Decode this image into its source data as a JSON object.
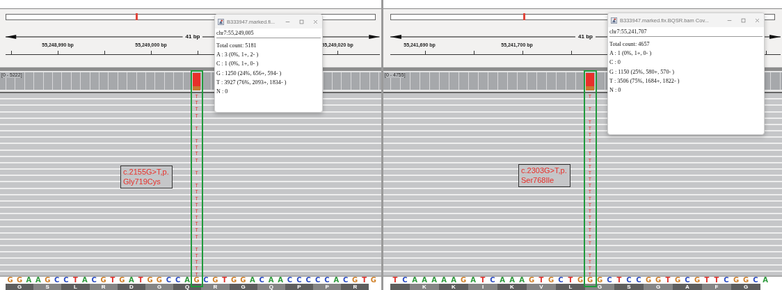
{
  "panels": [
    {
      "ruler": {
        "span_label": "41 bp",
        "ticks": [
          {
            "label": "55,248,990 bp"
          },
          {
            "label": "55,249,000 bp"
          },
          {
            "label": "55,249,020 bp"
          }
        ]
      },
      "coverage": {
        "range": "[0 - 5222]",
        "alleles": [
          {
            "color": "#e8302a",
            "level": 0.76
          },
          {
            "color": "#c9792f",
            "level": 0.24
          }
        ]
      },
      "reads": [
        {
          "mismatch": true,
          "base": "T"
        },
        {
          "mismatch": true,
          "base": "T"
        },
        {
          "mismatch": true,
          "base": "T"
        },
        {
          "mismatch": true,
          "base": "T"
        },
        {
          "mismatch": false
        },
        {
          "mismatch": true,
          "base": "T"
        },
        {
          "mismatch": false
        },
        {
          "mismatch": true,
          "base": "T"
        },
        {
          "mismatch": true,
          "base": "T"
        },
        {
          "mismatch": true,
          "base": "T"
        },
        {
          "mismatch": true,
          "base": "T"
        },
        {
          "mismatch": false
        },
        {
          "mismatch": true,
          "base": "T"
        },
        {
          "mismatch": false
        },
        {
          "mismatch": true,
          "base": "T"
        },
        {
          "mismatch": true,
          "base": "T"
        },
        {
          "mismatch": true,
          "base": "T"
        },
        {
          "mismatch": true,
          "base": "T"
        },
        {
          "mismatch": true,
          "base": "T"
        },
        {
          "mismatch": true,
          "base": "T"
        },
        {
          "mismatch": true,
          "base": "T"
        },
        {
          "mismatch": true,
          "base": "T"
        },
        {
          "mismatch": true,
          "base": "T"
        },
        {
          "mismatch": false
        },
        {
          "mismatch": true,
          "base": "T"
        },
        {
          "mismatch": true,
          "base": "T"
        },
        {
          "mismatch": true,
          "base": "T"
        },
        {
          "mismatch": true,
          "base": "T"
        },
        {
          "mismatch": true,
          "base": "T"
        }
      ],
      "annotation": [
        "c.2155G>T,p.",
        "Gly719Cys"
      ],
      "sequence_before": [
        {
          "base": "G",
          "color": "#d1832e"
        },
        {
          "base": "G",
          "color": "#d1832e"
        },
        {
          "base": "A",
          "color": "#2e9a3c"
        },
        {
          "base": "A",
          "color": "#2e9a3c"
        },
        {
          "base": "G",
          "color": "#d1832e"
        },
        {
          "base": "C",
          "color": "#2f4fc4"
        },
        {
          "base": "C",
          "color": "#2f4fc4"
        },
        {
          "base": "T",
          "color": "#e0312b"
        },
        {
          "base": "A",
          "color": "#2e9a3c"
        },
        {
          "base": "C",
          "color": "#2f4fc4"
        },
        {
          "base": "G",
          "color": "#d1832e"
        },
        {
          "base": "T",
          "color": "#e0312b"
        },
        {
          "base": "G",
          "color": "#d1832e"
        },
        {
          "base": "A",
          "color": "#2e9a3c"
        },
        {
          "base": "T",
          "color": "#e0312b"
        },
        {
          "base": "G",
          "color": "#d1832e"
        },
        {
          "base": "G",
          "color": "#d1832e"
        },
        {
          "base": "C",
          "color": "#2f4fc4"
        },
        {
          "base": "C",
          "color": "#2f4fc4"
        },
        {
          "base": "A",
          "color": "#2e9a3c"
        }
      ],
      "variant_base": {
        "base": "G",
        "color": "#d1832e"
      },
      "sequence_after": [
        {
          "base": "C",
          "color": "#2f4fc4"
        },
        {
          "base": "G",
          "color": "#d1832e"
        },
        {
          "base": "T",
          "color": "#e0312b"
        },
        {
          "base": "G",
          "color": "#d1832e"
        },
        {
          "base": "G",
          "color": "#d1832e"
        },
        {
          "base": "A",
          "color": "#2e9a3c"
        },
        {
          "base": "C",
          "color": "#2f4fc4"
        },
        {
          "base": "A",
          "color": "#2e9a3c"
        },
        {
          "base": "A",
          "color": "#2e9a3c"
        },
        {
          "base": "C",
          "color": "#2f4fc4"
        },
        {
          "base": "C",
          "color": "#2f4fc4"
        },
        {
          "base": "C",
          "color": "#2f4fc4"
        },
        {
          "base": "C",
          "color": "#2f4fc4"
        },
        {
          "base": "C",
          "color": "#2f4fc4"
        },
        {
          "base": "A",
          "color": "#2e9a3c"
        },
        {
          "base": "C",
          "color": "#2f4fc4"
        },
        {
          "base": "G",
          "color": "#d1832e"
        },
        {
          "base": "T",
          "color": "#e0312b"
        },
        {
          "base": "G",
          "color": "#d1832e"
        }
      ],
      "amino_acids": [
        {
          "cut": false,
          "letter": "G"
        },
        {
          "cut": false,
          "letter": "S"
        },
        {
          "cut": false,
          "letter": "L"
        },
        {
          "cut": false,
          "letter": "R"
        },
        {
          "cut": false,
          "letter": "D"
        },
        {
          "cut": false,
          "letter": "G"
        },
        {
          "cut": false,
          "letter": "Q"
        },
        {
          "cut": false,
          "letter": "R"
        },
        {
          "cut": false,
          "letter": "G"
        },
        {
          "cut": false,
          "letter": "Q"
        },
        {
          "cut": false,
          "letter": "P"
        },
        {
          "cut": false,
          "letter": "P"
        },
        {
          "cut": false,
          "letter": "R"
        }
      ],
      "popup": {
        "title": "B333947.marked.fi...",
        "position": "chr7:55,249,005",
        "lines": [
          "Total count: 5181",
          "A : 3 (0%, 1+, 2- )",
          "C : 1 (0%, 1+, 0- )",
          "G : 1250 (24%, 656+, 594- )",
          "T : 3927 (76%, 2093+, 1834- )",
          "N : 0"
        ]
      }
    },
    {
      "ruler": {
        "span_label": "41 bp",
        "ticks": [
          {
            "label": "55,241,690 bp"
          },
          {
            "label": "55,241,700 bp"
          }
        ]
      },
      "coverage": {
        "range": "[0 - 4755]",
        "alleles": [
          {
            "color": "#e8302a",
            "level": 0.75
          },
          {
            "color": "#c9792f",
            "level": 0.25
          }
        ]
      },
      "reads": [
        {
          "mismatch": true,
          "base": "T"
        },
        {
          "mismatch": false
        },
        {
          "mismatch": true,
          "base": "T"
        },
        {
          "mismatch": false
        },
        {
          "mismatch": true,
          "base": "T"
        },
        {
          "mismatch": true,
          "base": "T"
        },
        {
          "mismatch": true,
          "base": "T"
        },
        {
          "mismatch": true,
          "base": "T"
        },
        {
          "mismatch": false
        },
        {
          "mismatch": true,
          "base": "T"
        },
        {
          "mismatch": true,
          "base": "T"
        },
        {
          "mismatch": true,
          "base": "T"
        },
        {
          "mismatch": true,
          "base": "T"
        },
        {
          "mismatch": true,
          "base": "T"
        },
        {
          "mismatch": true,
          "base": "T"
        },
        {
          "mismatch": true,
          "base": "T"
        },
        {
          "mismatch": true,
          "base": "T"
        },
        {
          "mismatch": true,
          "base": "T"
        },
        {
          "mismatch": true,
          "base": "T"
        },
        {
          "mismatch": true,
          "base": "T"
        },
        {
          "mismatch": true,
          "base": "T"
        },
        {
          "mismatch": true,
          "base": "T"
        },
        {
          "mismatch": true,
          "base": "T"
        },
        {
          "mismatch": true,
          "base": "T"
        },
        {
          "mismatch": false
        },
        {
          "mismatch": true,
          "base": "T"
        },
        {
          "mismatch": true,
          "base": "T"
        },
        {
          "mismatch": true,
          "base": "T"
        },
        {
          "mismatch": true,
          "base": "T"
        }
      ],
      "annotation": [
        "c.2303G>T,p.",
        "Ser768Ile"
      ],
      "sequence_before": [
        {
          "base": "T",
          "color": "#e0312b"
        },
        {
          "base": "C",
          "color": "#2f4fc4"
        },
        {
          "base": "A",
          "color": "#2e9a3c"
        },
        {
          "base": "A",
          "color": "#2e9a3c"
        },
        {
          "base": "A",
          "color": "#2e9a3c"
        },
        {
          "base": "A",
          "color": "#2e9a3c"
        },
        {
          "base": "A",
          "color": "#2e9a3c"
        },
        {
          "base": "G",
          "color": "#d1832e"
        },
        {
          "base": "A",
          "color": "#2e9a3c"
        },
        {
          "base": "T",
          "color": "#e0312b"
        },
        {
          "base": "C",
          "color": "#2f4fc4"
        },
        {
          "base": "A",
          "color": "#2e9a3c"
        },
        {
          "base": "A",
          "color": "#2e9a3c"
        },
        {
          "base": "A",
          "color": "#2e9a3c"
        },
        {
          "base": "G",
          "color": "#d1832e"
        },
        {
          "base": "T",
          "color": "#e0312b"
        },
        {
          "base": "G",
          "color": "#d1832e"
        },
        {
          "base": "C",
          "color": "#2f4fc4"
        },
        {
          "base": "T",
          "color": "#e0312b"
        },
        {
          "base": "G",
          "color": "#d1832e"
        }
      ],
      "variant_base": {
        "base": "G",
        "color": "#d1832e"
      },
      "sequence_after": [
        {
          "base": "G",
          "color": "#d1832e"
        },
        {
          "base": "C",
          "color": "#2f4fc4"
        },
        {
          "base": "T",
          "color": "#e0312b"
        },
        {
          "base": "C",
          "color": "#2f4fc4"
        },
        {
          "base": "C",
          "color": "#2f4fc4"
        },
        {
          "base": "G",
          "color": "#d1832e"
        },
        {
          "base": "G",
          "color": "#d1832e"
        },
        {
          "base": "T",
          "color": "#e0312b"
        },
        {
          "base": "G",
          "color": "#d1832e"
        },
        {
          "base": "C",
          "color": "#2f4fc4"
        },
        {
          "base": "G",
          "color": "#d1832e"
        },
        {
          "base": "T",
          "color": "#e0312b"
        },
        {
          "base": "T",
          "color": "#e0312b"
        },
        {
          "base": "C",
          "color": "#2f4fc4"
        },
        {
          "base": "G",
          "color": "#d1832e"
        },
        {
          "base": "G",
          "color": "#d1832e"
        },
        {
          "base": "C",
          "color": "#2f4fc4"
        },
        {
          "base": "A",
          "color": "#2e9a3c"
        }
      ],
      "amino_acids": [
        {
          "cut": true
        },
        {
          "cut": false,
          "letter": "K"
        },
        {
          "cut": false,
          "letter": "K"
        },
        {
          "cut": false,
          "letter": "I"
        },
        {
          "cut": false,
          "letter": "K"
        },
        {
          "cut": false,
          "letter": "V"
        },
        {
          "cut": false,
          "letter": "L"
        },
        {
          "cut": false,
          "letter": "G"
        },
        {
          "cut": false,
          "letter": "S"
        },
        {
          "cut": false,
          "letter": "G"
        },
        {
          "cut": false,
          "letter": "A"
        },
        {
          "cut": false,
          "letter": "F"
        },
        {
          "cut": false,
          "letter": "G"
        }
      ],
      "popup": {
        "title": "B333947.marked.fix.BQSR.bam Cov...",
        "position": "chr7:55,241,707",
        "lines": [
          "Total count: 4657",
          "A : 1 (0%, 1+, 0- )",
          "C : 0",
          "G : 1150 (25%, 580+, 570- )",
          "T : 3506 (75%, 1684+, 1822- )",
          "N : 0"
        ]
      }
    }
  ]
}
